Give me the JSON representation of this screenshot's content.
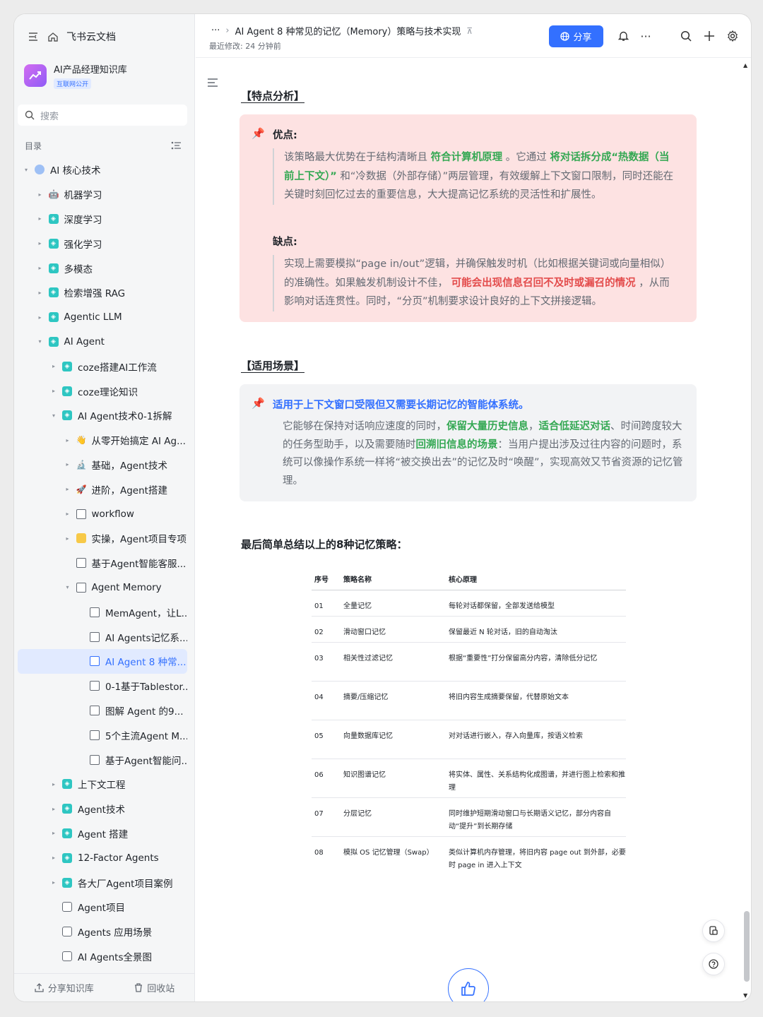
{
  "sidebar": {
    "app_name": "飞书云文档",
    "kb_title": "AI产品经理知识库",
    "kb_badge": "互联网公开",
    "search_placeholder": "搜索",
    "toc_label": "目录",
    "items": [
      {
        "label": "AI 核心技术",
        "caret": "▾",
        "icon": "globe"
      },
      {
        "label": "机器学习",
        "caret": "▸",
        "icon": "robot"
      },
      {
        "label": "深度学习",
        "caret": "▸",
        "icon": "teal"
      },
      {
        "label": "强化学习",
        "caret": "▸",
        "icon": "teal"
      },
      {
        "label": "多模态",
        "caret": "▸",
        "icon": "teal"
      },
      {
        "label": "检索增强 RAG",
        "caret": "▸",
        "icon": "teal"
      },
      {
        "label": "Agentic LLM",
        "caret": "▸",
        "icon": "teal"
      },
      {
        "label": "AI Agent",
        "caret": "▾",
        "icon": "teal"
      },
      {
        "label": "coze搭建AI工作流",
        "caret": "▸",
        "icon": "teal"
      },
      {
        "label": "coze理论知识",
        "caret": "▸",
        "icon": "teal"
      },
      {
        "label": "AI Agent技术0-1拆解",
        "caret": "▾",
        "icon": "teal"
      },
      {
        "label": "从零开始搞定 AI Ag...",
        "caret": "▸",
        "icon": "emoji"
      },
      {
        "label": "基础，Agent技术",
        "caret": "▸",
        "icon": "emoji"
      },
      {
        "label": "进阶，Agent搭建",
        "caret": "▸",
        "icon": "emoji"
      },
      {
        "label": "workflow",
        "caret": "▸",
        "icon": "doc"
      },
      {
        "label": "实操，Agent项目专项",
        "caret": "▸",
        "icon": "yellow"
      },
      {
        "label": "基于Agent智能客服...",
        "caret": "",
        "icon": "doc"
      },
      {
        "label": "Agent Memory",
        "caret": "▾",
        "icon": "doc"
      },
      {
        "label": "MemAgent，让L...",
        "caret": "",
        "icon": "doc"
      },
      {
        "label": "AI Agents记忆系...",
        "caret": "",
        "icon": "doc"
      },
      {
        "label": "AI Agent 8 种常...",
        "caret": "",
        "icon": "doc-blue"
      },
      {
        "label": "0-1基于Tablestor...",
        "caret": "",
        "icon": "doc"
      },
      {
        "label": "图解 Agent 的9...",
        "caret": "",
        "icon": "doc"
      },
      {
        "label": "5个主流Agent M...",
        "caret": "",
        "icon": "doc"
      },
      {
        "label": "基于Agent智能问...",
        "caret": "",
        "icon": "doc"
      },
      {
        "label": "上下文工程",
        "caret": "▸",
        "icon": "teal"
      },
      {
        "label": "Agent技术",
        "caret": "▸",
        "icon": "teal"
      },
      {
        "label": "Agent 搭建",
        "caret": "▸",
        "icon": "teal"
      },
      {
        "label": "12-Factor Agents",
        "caret": "▸",
        "icon": "teal"
      },
      {
        "label": "各大厂Agent项目案例",
        "caret": "▸",
        "icon": "teal"
      },
      {
        "label": "Agent项目",
        "caret": "",
        "icon": "mindmap"
      },
      {
        "label": "Agents 应用场景",
        "caret": "",
        "icon": "mindmap"
      },
      {
        "label": "AI Agents全景图",
        "caret": "",
        "icon": "mindmap"
      }
    ],
    "footer_share": "分享知识库",
    "footer_trash": "回收站"
  },
  "header": {
    "breadcrumb_more": "···",
    "doc_title": "AI Agent 8 种常见的记忆（Memory）策略与技术实现",
    "last_modified": "最近修改: 24 分钟前",
    "share_label": "分享"
  },
  "content": {
    "section1_title": "【特点分析】",
    "pros_head": "优点:",
    "pros": {
      "p1": "该策略最大优势在于结构清晰且 ",
      "hl1": "符合计算机原理",
      "p2": " 。它通过 ",
      "hl2": "将对话拆分成“热数据（当前上下文）”",
      "p3": " 和“冷数据（外部存储）”两层管理，有效缓解上下文窗口限制，同时还能在关键时刻回忆过去的重要信息，大大提高记忆系统的灵活性和扩展性。"
    },
    "cons_head": "缺点:",
    "cons": {
      "p1": "实现上需要模拟“page in/out”逻辑，并确保触发时机（比如根据关键词或向量相似）的准确性。如果触发机制设计不佳， ",
      "hl1": "可能会出现信息召回不及时或漏召的情况",
      "p2": " ，从而影响对话连贯性。同时，“分页”机制要求设计良好的上下文拼接逻辑。"
    },
    "section2_title": "【适用场景】",
    "scene_head": "适用于上下文窗口受限但又需要长期记忆的智能体系统。",
    "scene": {
      "p1": "它能够在保持对话响应速度的同时，",
      "hl1": "保留大量历史信息",
      "p2": "，",
      "hl2": "适合低延迟对话",
      "p3": "、时间跨度较大的任务型助手，以及需要随时",
      "hl3": "回溯旧信息的场景",
      "p4": "：当用户提出涉及过往内容的问题时，系统可以像操作系统一样将“被交换出去”的记忆及时“唤醒”，实现高效又节省资源的记忆管理。"
    },
    "summary_title": "最后简单总结以上的8种记忆策略：",
    "table": {
      "headers": [
        "序号",
        "策略名称",
        "核心原理"
      ],
      "rows": [
        [
          "01",
          "全量记忆",
          "每轮对话都保留，全部发送给模型"
        ],
        [
          "02",
          "滑动窗口记忆",
          "保留最近 N 轮对话，旧的自动淘汰"
        ],
        [
          "03",
          "相关性过滤记忆",
          "根据“重要性”打分保留高分内容，清除低分记忆"
        ],
        [
          "04",
          "摘要/压缩记忆",
          "将旧内容生成摘要保留，代替原始文本"
        ],
        [
          "05",
          "向量数据库记忆",
          "对对话进行嵌入，存入向量库，按语义检索"
        ],
        [
          "06",
          "知识图谱记忆",
          "将实体、属性、关系结构化成图谱，并进行图上检索和推理"
        ],
        [
          "07",
          "分层记忆",
          "同时维护短期滑动窗口与长期语义记忆，部分内容自动“提升”到长期存储"
        ],
        [
          "08",
          "模拟 OS 记忆管理（Swap）",
          "类似计算机内存管理，将旧内容 page out 到外部，必要时 page in 进入上下文"
        ]
      ]
    }
  },
  "colors": {
    "accent": "#3370ff",
    "callout_red": "#fde2e2",
    "callout_grey": "#f2f3f5",
    "highlight_green": "#34a853",
    "highlight_red": "#e34c4c"
  }
}
